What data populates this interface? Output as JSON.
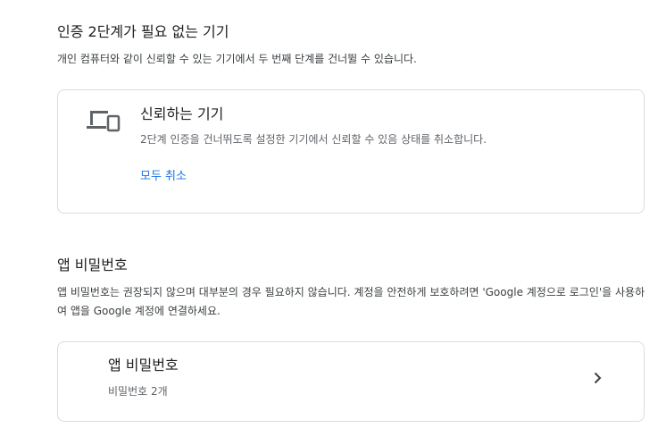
{
  "trusted_section": {
    "title": "인증 2단계가 필요 없는 기기",
    "description": "개인 컴퓨터와 같이 신뢰할 수 있는 기기에서 두 번째 단계를 건너뛸 수 있습니다.",
    "card": {
      "icon": "devices-icon",
      "title": "신뢰하는 기기",
      "subtitle": "2단계 인증을 건너뛰도록 설정한 기기에서 신뢰할 수 있음 상태를 취소합니다.",
      "action_label": "모두 취소"
    }
  },
  "app_password_section": {
    "title": "앱 비밀번호",
    "description": "앱 비밀번호는 권장되지 않으며 대부분의 경우 필요하지 않습니다. 계정을 안전하게 보호하려면 'Google 계정으로 로그인'을 사용하여 앱을 Google 계정에 연결하세요.",
    "card": {
      "title": "앱 비밀번호",
      "subtitle": "비밀번호 2개",
      "icon": "chevron-right-icon"
    }
  },
  "colors": {
    "link": "#1a73e8",
    "border": "#dadce0",
    "text_primary": "#202124",
    "text_secondary": "#5f6368"
  }
}
